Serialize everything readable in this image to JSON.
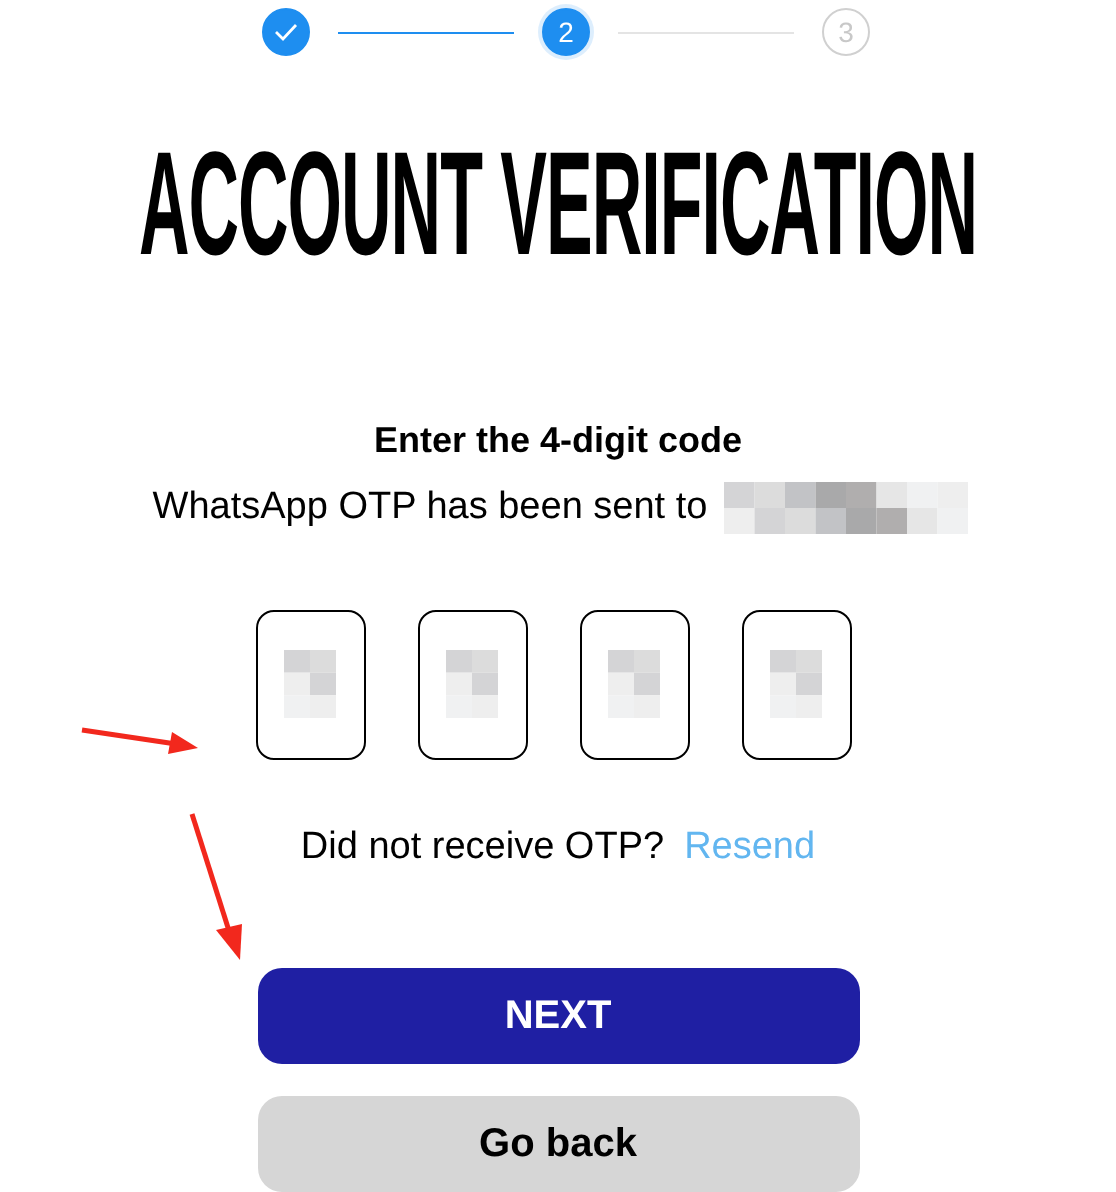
{
  "steps": [
    {
      "done": true,
      "selected": false
    },
    {
      "label": "2",
      "done": false,
      "selected": true
    },
    {
      "label": "3",
      "done": false,
      "selected": false
    }
  ],
  "title": "ACCOUNT VERIFICATION",
  "subtitle": "Enter the 4-digit code",
  "message": "WhatsApp OTP has been sent to",
  "otp_boxes": [
    {
      "filled": true
    },
    {
      "filled": true
    },
    {
      "filled": true
    },
    {
      "filled": true
    }
  ],
  "resend_prompt": "Did not receive OTP?",
  "resend_link": "Resend",
  "buttons": [
    {
      "label": "NEXT",
      "kind": "primary"
    },
    {
      "label": "Go back",
      "kind": "secondary"
    }
  ]
}
